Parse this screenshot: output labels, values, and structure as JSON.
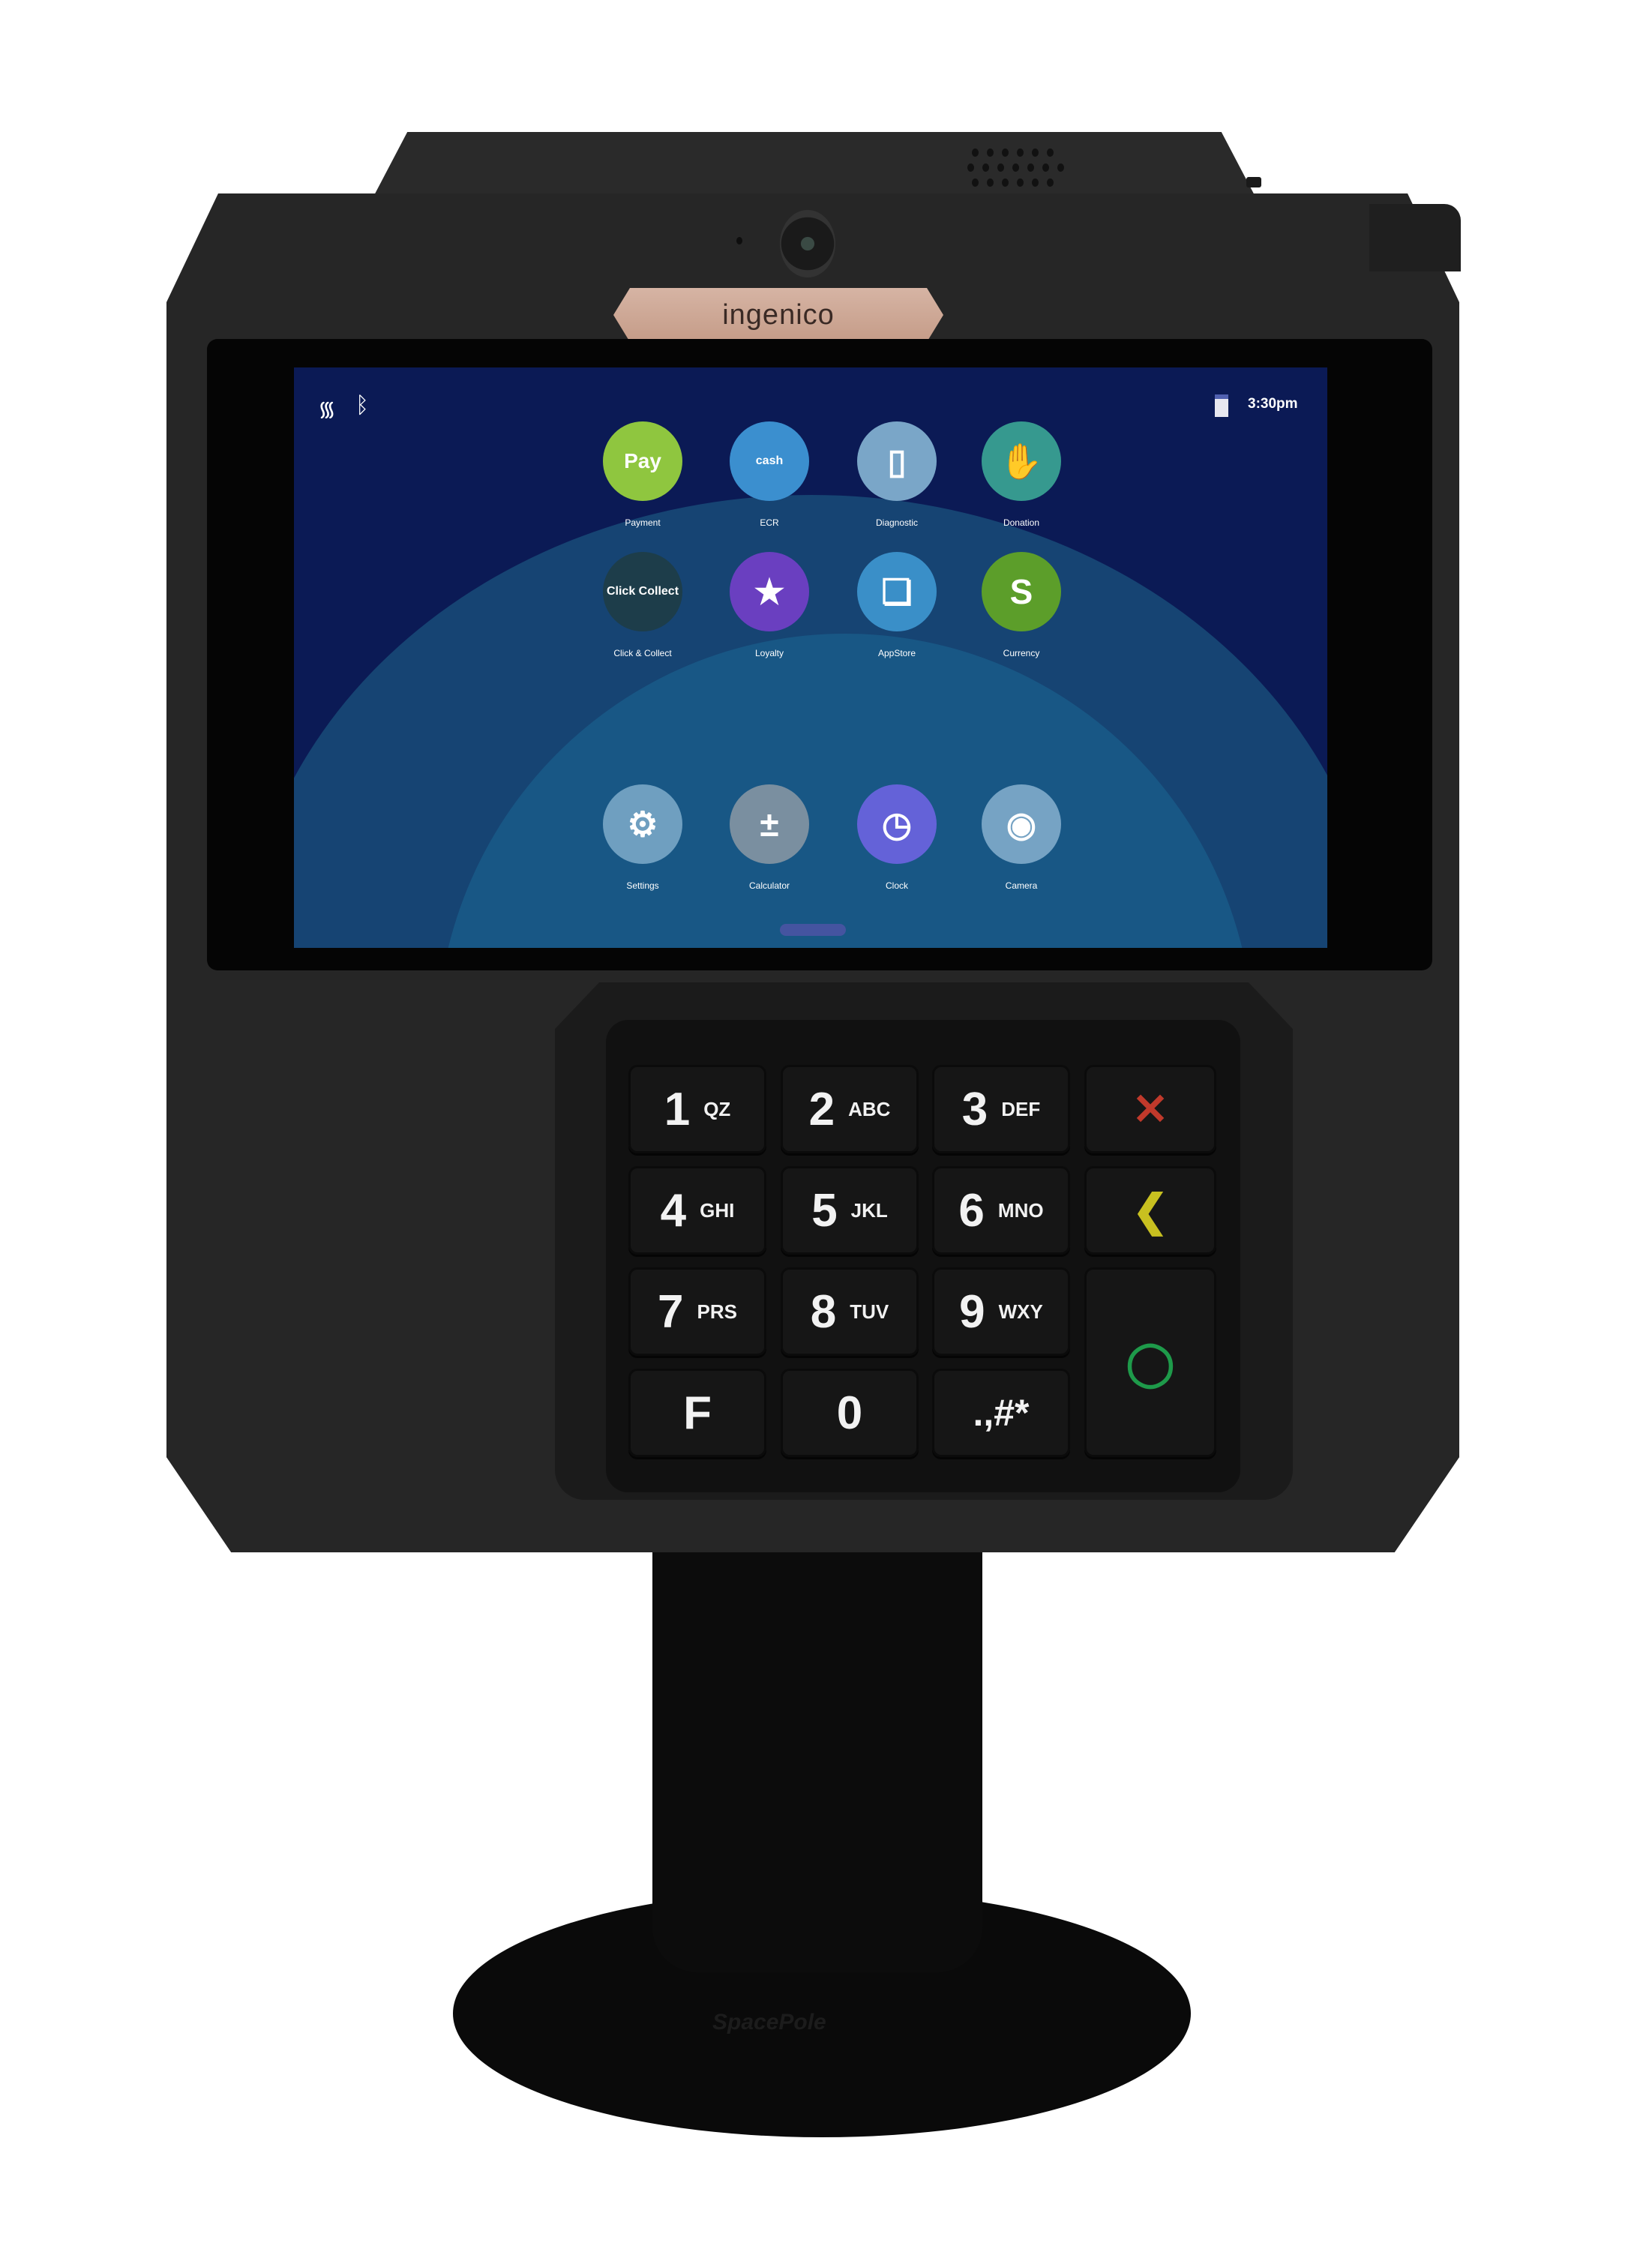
{
  "device": {
    "brand": "ingenico",
    "stand_brand": "SpacePole"
  },
  "status_bar": {
    "wifi_icon": "wifi-icon",
    "bluetooth_icon": "bluetooth-icon",
    "battery_icon": "battery-icon",
    "time": "3:30pm"
  },
  "apps": [
    {
      "label": "Payment",
      "icon": "pay-icon",
      "glyph": "Pay",
      "color": "#8fc63f"
    },
    {
      "label": "ECR",
      "icon": "cash-register-icon",
      "glyph": "cash",
      "color": "#3b8fcf"
    },
    {
      "label": "Diagnostic",
      "icon": "terminal-gear-icon",
      "glyph": "▯",
      "color": "#7aa6c8"
    },
    {
      "label": "Donation",
      "icon": "hand-heart-icon",
      "glyph": "✋",
      "color": "#36998f"
    },
    {
      "label": "Click & Collect",
      "icon": "click-collect-icon",
      "glyph": "Click Collect",
      "color": "#1d3d4a"
    },
    {
      "label": "Loyalty",
      "icon": "loyalty-star-icon",
      "glyph": "★",
      "color": "#6a3fc0"
    },
    {
      "label": "AppStore",
      "icon": "appstore-icon",
      "glyph": "❏",
      "color": "#3a8fc8"
    },
    {
      "label": "Currency",
      "icon": "currency-icon",
      "glyph": "S",
      "color": "#5c9e2a"
    },
    {
      "label": "Settings",
      "icon": "gear-icon",
      "glyph": "⚙",
      "color": "#6f9fc0"
    },
    {
      "label": "Calculator",
      "icon": "calculator-icon",
      "glyph": "±",
      "color": "#7a8fa0"
    },
    {
      "label": "Clock",
      "icon": "clock-icon",
      "glyph": "◷",
      "color": "#6462d8"
    },
    {
      "label": "Camera",
      "icon": "camera-icon",
      "glyph": "◉",
      "color": "#76a3c4"
    }
  ],
  "keypad": {
    "keys": [
      {
        "n": "1",
        "s": "QZ"
      },
      {
        "n": "2",
        "s": "ABC"
      },
      {
        "n": "3",
        "s": "DEF"
      },
      {
        "n": "4",
        "s": "GHI"
      },
      {
        "n": "5",
        "s": "JKL"
      },
      {
        "n": "6",
        "s": "MNO"
      },
      {
        "n": "7",
        "s": "PRS"
      },
      {
        "n": "8",
        "s": "TUV"
      },
      {
        "n": "9",
        "s": "WXY"
      },
      {
        "n": "F",
        "s": ""
      },
      {
        "n": "0",
        "s": ""
      },
      {
        "n": ".,#*",
        "s": ""
      }
    ],
    "cancel": {
      "icon": "cancel-x-icon",
      "glyph": "✕",
      "color": "#c0392b"
    },
    "correct": {
      "icon": "backspace-icon",
      "glyph": "❮",
      "color": "#c8c020"
    },
    "enter": {
      "icon": "enter-o-icon",
      "glyph": "◯",
      "color": "#1e9a4a"
    }
  }
}
